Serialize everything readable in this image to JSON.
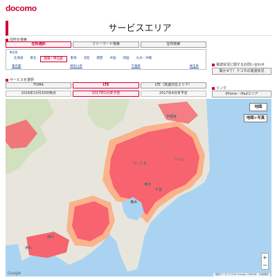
{
  "header": {
    "logo": "docomo",
    "title": "サービスエリア"
  },
  "address_search": {
    "label": "住所を検索",
    "tabs": [
      {
        "label": "住所選択",
        "active": true
      },
      {
        "label": "フリーワード検索",
        "active": false
      },
      {
        "label": "住所検索",
        "active": false
      }
    ],
    "expand_label": "▼全国",
    "regions": [
      {
        "label": "北海道"
      },
      {
        "label": "東北"
      },
      {
        "label": "関東・甲信越",
        "active": true
      },
      {
        "label": "東海"
      },
      {
        "label": "北陸"
      },
      {
        "label": "関西"
      },
      {
        "label": "中国"
      },
      {
        "label": "四国"
      },
      {
        "label": "九州・沖縄"
      }
    ],
    "prefectures": [
      "東京都",
      "神奈川県",
      "千葉県",
      "埼玉県"
    ]
  },
  "service": {
    "label": "サービスを選択",
    "modes": [
      {
        "label": "FOMA"
      },
      {
        "label": "LTE",
        "active": true
      },
      {
        "label": "LTE（高速対応エリア）"
      }
    ],
    "dates": [
      {
        "label": "2016年10月30日時点"
      },
      {
        "label": "2017年1月末予定",
        "active": true
      },
      {
        "label": "2017年4月末予定"
      }
    ]
  },
  "inquiry": {
    "label": "電波状況に関するお問い合わせ",
    "button": "聞かせて！ドコモの電波状況"
  },
  "link": {
    "label": "リンク",
    "button": "iPhone・iPadエリア"
  },
  "map": {
    "buttons": {
      "map": "地図",
      "hybrid": "地図+写真"
    },
    "zoom_in": "+",
    "zoom_out": "−",
    "attribution": "地図データ ©2016 Google, ZENRIN　利用規約",
    "google": "Google",
    "colors": {
      "coverage": "#f7636e",
      "coverage_edge": "#fbb38c",
      "sea": "#aad3f2",
      "land": "#e8e6dc"
    },
    "places": [
      {
        "name": "東京"
      },
      {
        "name": "横浜"
      },
      {
        "name": "千葉"
      },
      {
        "name": "さいたま"
      },
      {
        "name": "つくば"
      },
      {
        "name": "静岡"
      },
      {
        "name": "浜松"
      },
      {
        "name": "宇都宮"
      }
    ]
  }
}
